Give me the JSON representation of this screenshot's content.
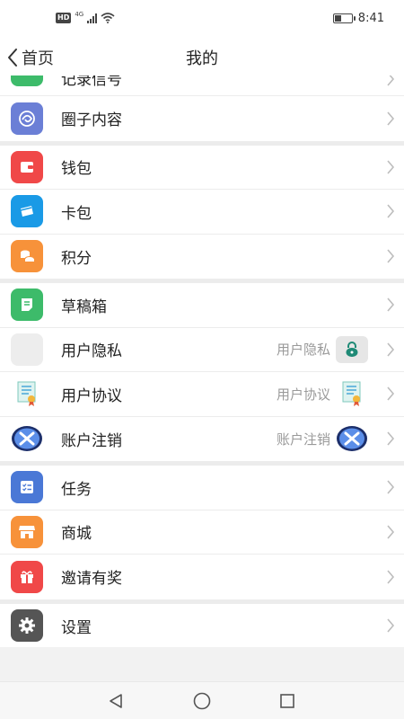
{
  "status_bar": {
    "hd": "HD",
    "network": "4G",
    "time": "8:41"
  },
  "nav": {
    "back_label": "首页",
    "title": "我的"
  },
  "menu": {
    "partial_item": {
      "label": "记录信号",
      "icon": "partial-green-icon",
      "color": "#3dbb6a"
    },
    "group1": [
      {
        "label": "圈子内容",
        "icon": "swirl-icon",
        "color": "#6b7fd6"
      }
    ],
    "group2": [
      {
        "label": "钱包",
        "icon": "wallet-icon",
        "color": "#f04848"
      },
      {
        "label": "卡包",
        "icon": "card-icon",
        "color": "#1a9ae6"
      },
      {
        "label": "积分",
        "icon": "coins-icon",
        "color": "#f7923a"
      }
    ],
    "group3": [
      {
        "label": "草稿箱",
        "icon": "draft-icon",
        "color": "#3dbb6a"
      },
      {
        "label": "用户隐私",
        "right_text": "用户隐私",
        "icon": "blank-icon",
        "right_icon": "lock-icon",
        "color": "#ededed"
      },
      {
        "label": "用户协议",
        "right_text": "用户协议",
        "icon": "certificate-icon",
        "right_icon": "certificate-icon"
      },
      {
        "label": "账户注销",
        "right_text": "账户注销",
        "icon": "x-circle-icon",
        "right_icon": "x-circle-icon"
      }
    ],
    "group4": [
      {
        "label": "任务",
        "icon": "checklist-icon",
        "color": "#4a78d6"
      },
      {
        "label": "商城",
        "icon": "store-icon",
        "color": "#f7923a"
      },
      {
        "label": "邀请有奖",
        "icon": "gift-icon",
        "color": "#f04848"
      }
    ],
    "group5": [
      {
        "label": "设置",
        "icon": "gear-icon",
        "color": "#555555"
      }
    ]
  },
  "colors": {
    "chevron": "#bdbdbd",
    "separator": "#ececec",
    "lock_teal": "#1f8a76"
  }
}
